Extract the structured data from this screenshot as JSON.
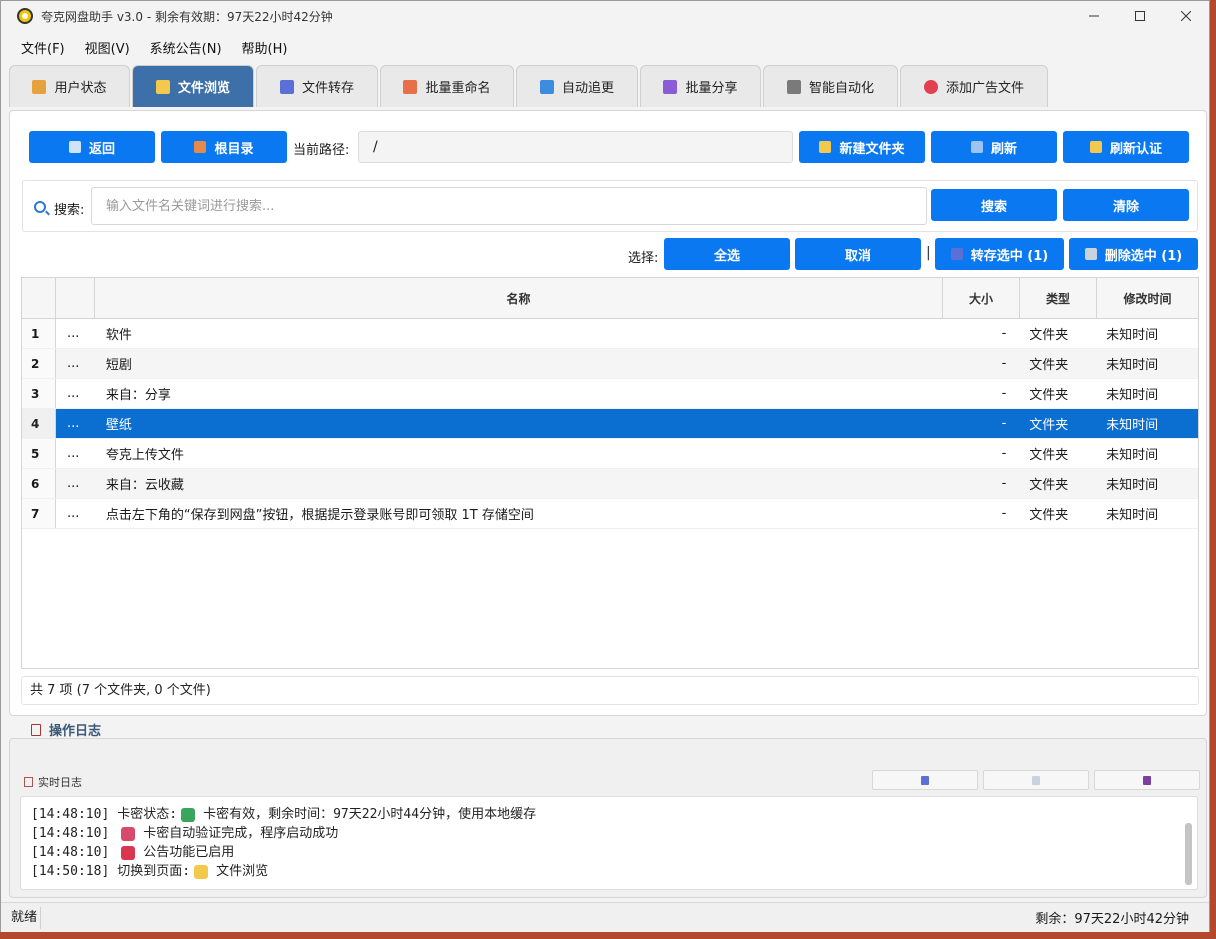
{
  "window": {
    "title": "夸克网盘助手 v3.0 - 剩余有效期：97天22小时42分钟"
  },
  "menu": [
    {
      "label": "文件(F)"
    },
    {
      "label": "视图(V)"
    },
    {
      "label": "系统公告(N)"
    },
    {
      "label": "帮助(H)"
    }
  ],
  "tabs": [
    {
      "label": "用户状态",
      "icon": "lock-icon",
      "active": false
    },
    {
      "label": "文件浏览",
      "icon": "folder-icon",
      "active": true
    },
    {
      "label": "文件转存",
      "icon": "transfer-icon",
      "active": false
    },
    {
      "label": "批量重命名",
      "icon": "pencil-icon",
      "active": false
    },
    {
      "label": "自动追更",
      "icon": "refresh-icon",
      "active": false
    },
    {
      "label": "批量分享",
      "icon": "share-icon",
      "active": false
    },
    {
      "label": "智能自动化",
      "icon": "robot-icon",
      "active": false
    },
    {
      "label": "添加广告文件",
      "icon": "target-icon",
      "active": false
    }
  ],
  "toolbar": {
    "back_label": "返回",
    "root_label": "根目录",
    "path_label": "当前路径:",
    "path_value": "/",
    "new_folder_label": "新建文件夹",
    "refresh_label": "刷新",
    "reauth_label": "刷新认证"
  },
  "search": {
    "label": "搜索:",
    "placeholder": "输入文件名关键词进行搜索...",
    "search_button": "搜索",
    "clear_button": "清除"
  },
  "selection": {
    "label": "选择:",
    "select_all": "全选",
    "cancel": "取消",
    "separator": "|",
    "transfer_selected": "转存选中 (1)",
    "delete_selected": "删除选中 (1)"
  },
  "table": {
    "headers": {
      "name": "名称",
      "size": "大小",
      "type": "类型",
      "mtime": "修改时间"
    },
    "rows": [
      {
        "num": "1",
        "dots": "...",
        "name": "软件",
        "size": "-",
        "type": "文件夹",
        "mtime": "未知时间",
        "selected": false
      },
      {
        "num": "2",
        "dots": "...",
        "name": "短剧",
        "size": "-",
        "type": "文件夹",
        "mtime": "未知时间",
        "selected": false
      },
      {
        "num": "3",
        "dots": "...",
        "name": "来自：分享",
        "size": "-",
        "type": "文件夹",
        "mtime": "未知时间",
        "selected": false
      },
      {
        "num": "4",
        "dots": "...",
        "name": "壁纸",
        "size": "-",
        "type": "文件夹",
        "mtime": "未知时间",
        "selected": true
      },
      {
        "num": "5",
        "dots": "...",
        "name": "夸克上传文件",
        "size": "-",
        "type": "文件夹",
        "mtime": "未知时间",
        "selected": false
      },
      {
        "num": "6",
        "dots": "...",
        "name": "来自：云收藏",
        "size": "-",
        "type": "文件夹",
        "mtime": "未知时间",
        "selected": false
      },
      {
        "num": "7",
        "dots": "...",
        "name": "点击左下角的“保存到网盘”按钮，根据提示登录账号即可领取 1T 存储空间",
        "size": "-",
        "type": "文件夹",
        "mtime": "未知时间",
        "selected": false
      }
    ]
  },
  "summary": "共 7 项 (7 个文件夹, 0 个文件)",
  "log": {
    "title": "操作日志",
    "realtime_label": "实时日志",
    "lines": [
      {
        "time": "[14:48:10]",
        "prefix": "卡密状态:",
        "emoji": "check-icon",
        "emoji_color": "#3aa55d",
        "text": "卡密有效，剩余时间：97天22小时44分钟，使用本地缓存"
      },
      {
        "time": "[14:48:10]",
        "prefix": "",
        "emoji": "rocket-icon",
        "emoji_color": "#d64a6a",
        "text": "卡密自动验证完成，程序启动成功"
      },
      {
        "time": "[14:48:10]",
        "prefix": "",
        "emoji": "megaphone-icon",
        "emoji_color": "#d9364f",
        "text": "公告功能已启用"
      },
      {
        "time": "[14:50:18]",
        "prefix": "切换到页面:",
        "emoji": "folder-icon",
        "emoji_color": "#f2c94c",
        "text": "文件浏览"
      }
    ]
  },
  "status": {
    "left": "就绪",
    "right": "剩余：97天22小时42分钟"
  },
  "colors": {
    "accent": "#0a78f0",
    "active_tab": "#3d6fa8",
    "selected_row": "#0a6fd1"
  }
}
